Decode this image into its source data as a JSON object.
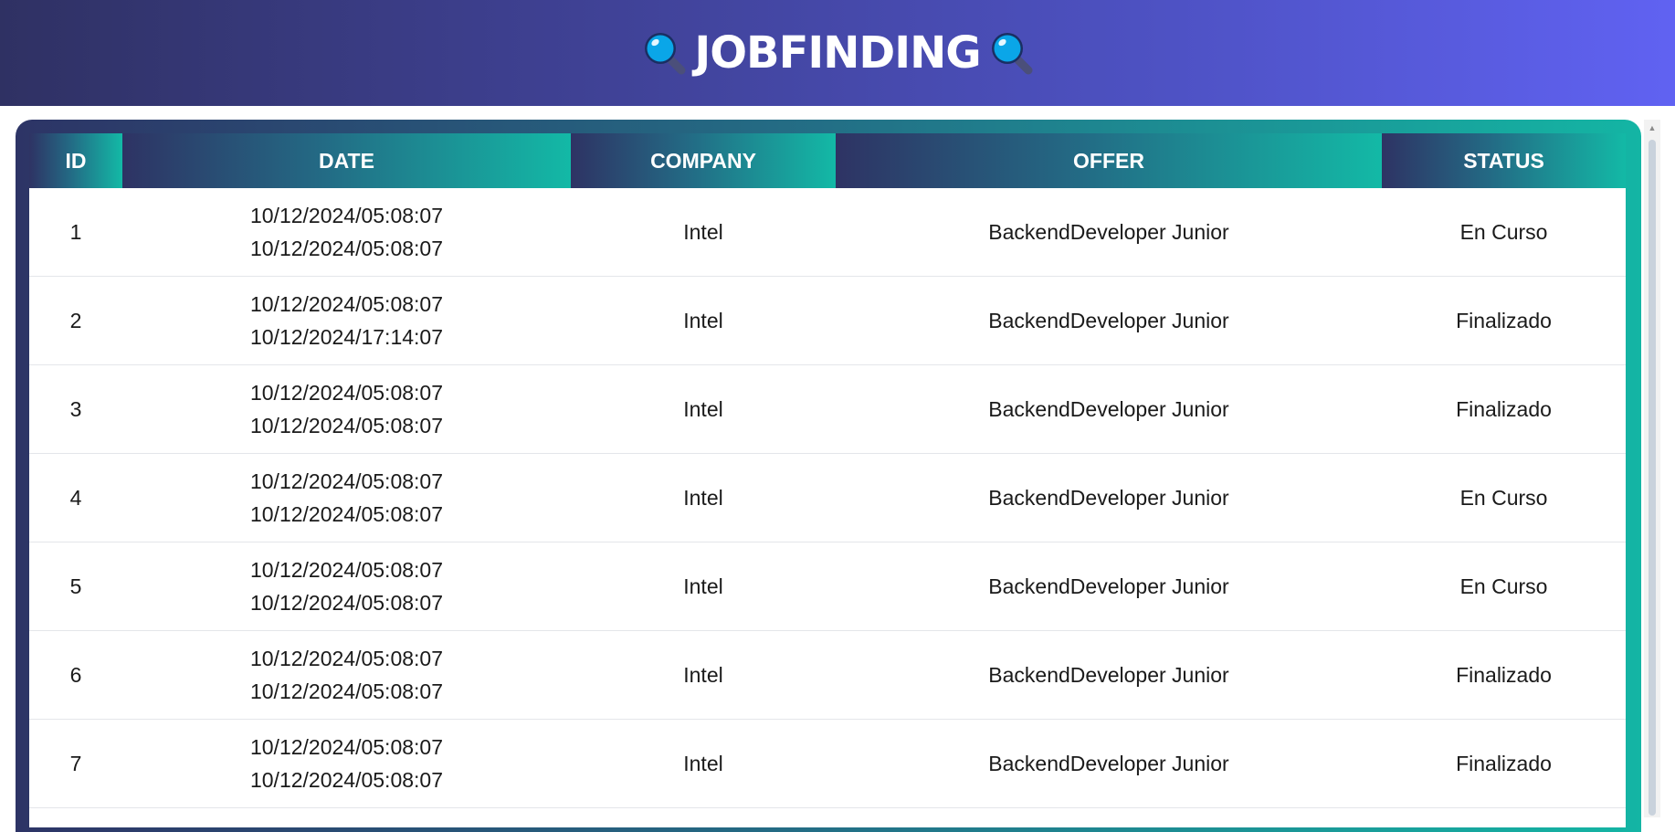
{
  "header": {
    "title": "JOBFINDING",
    "left_icon": "magnifier-icon",
    "right_icon": "magnifier-icon"
  },
  "colors": {
    "header_gradient_start": "#2f3163",
    "header_gradient_end": "#6062f2",
    "table_gradient_start": "#2d3466",
    "table_gradient_end": "#14b5a4",
    "magnifier_lens": "#0aa6e8"
  },
  "table": {
    "columns": [
      "ID",
      "DATE",
      "COMPANY",
      "OFFER",
      "STATUS"
    ],
    "rows": [
      {
        "id": "1",
        "date_start": "10/12/2024/05:08:07",
        "date_end": "10/12/2024/05:08:07",
        "company": "Intel",
        "offer": "BackendDeveloper Junior",
        "status": "En Curso"
      },
      {
        "id": "2",
        "date_start": "10/12/2024/05:08:07",
        "date_end": "10/12/2024/17:14:07",
        "company": "Intel",
        "offer": "BackendDeveloper Junior",
        "status": "Finalizado"
      },
      {
        "id": "3",
        "date_start": "10/12/2024/05:08:07",
        "date_end": "10/12/2024/05:08:07",
        "company": "Intel",
        "offer": "BackendDeveloper Junior",
        "status": "Finalizado"
      },
      {
        "id": "4",
        "date_start": "10/12/2024/05:08:07",
        "date_end": "10/12/2024/05:08:07",
        "company": "Intel",
        "offer": "BackendDeveloper Junior",
        "status": "En Curso"
      },
      {
        "id": "5",
        "date_start": "10/12/2024/05:08:07",
        "date_end": "10/12/2024/05:08:07",
        "company": "Intel",
        "offer": "BackendDeveloper Junior",
        "status": "En Curso"
      },
      {
        "id": "6",
        "date_start": "10/12/2024/05:08:07",
        "date_end": "10/12/2024/05:08:07",
        "company": "Intel",
        "offer": "BackendDeveloper Junior",
        "status": "Finalizado"
      },
      {
        "id": "7",
        "date_start": "10/12/2024/05:08:07",
        "date_end": "10/12/2024/05:08:07",
        "company": "Intel",
        "offer": "BackendDeveloper Junior",
        "status": "Finalizado"
      }
    ]
  }
}
